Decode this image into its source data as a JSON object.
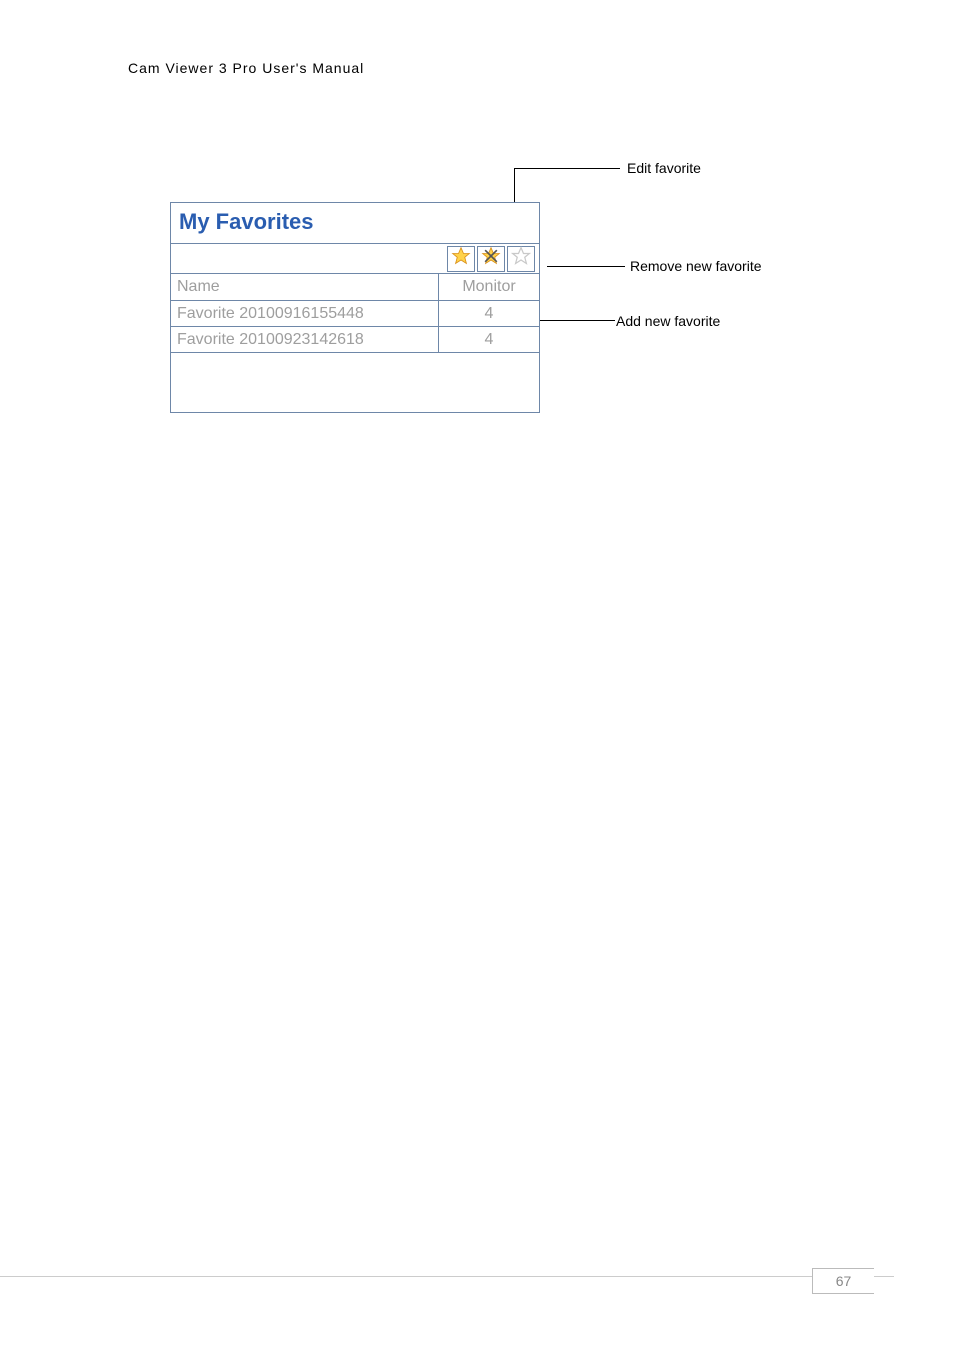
{
  "header": {
    "title": "Cam  Viewer  3  Pro  User's  Manual"
  },
  "callouts": {
    "edit": "Edit favorite",
    "remove": "Remove new favorite",
    "add": "Add new favorite"
  },
  "panel": {
    "title": "My Favorites",
    "columns": {
      "name": "Name",
      "monitor": "Monitor"
    },
    "rows": [
      {
        "name": "Favorite 20100916155448",
        "monitor": "4"
      },
      {
        "name": "Favorite 20100923142618",
        "monitor": "4"
      }
    ],
    "icons": {
      "edit": "edit-favorite-icon",
      "remove": "remove-favorite-icon",
      "add": "add-favorite-icon"
    }
  },
  "footer": {
    "page": "67"
  }
}
